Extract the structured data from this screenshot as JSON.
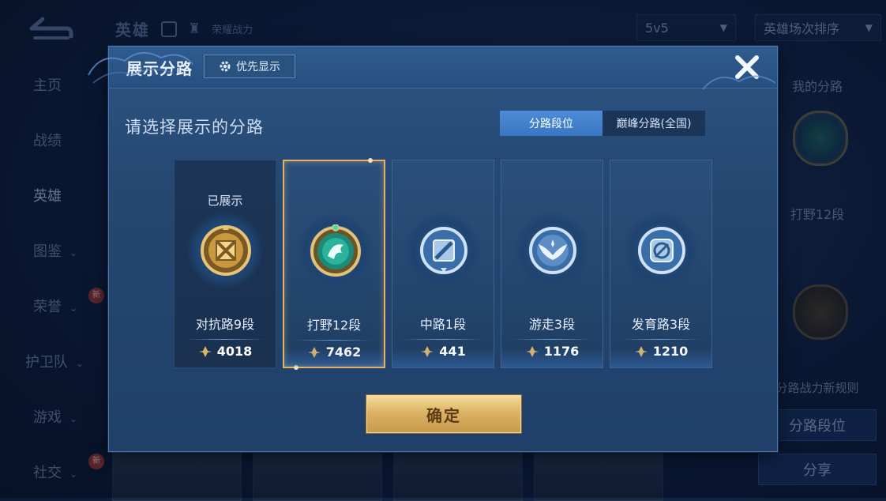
{
  "background": {
    "top_title": "英雄",
    "top_subtitle": "荣耀战力",
    "mode_dropdown": "5v5",
    "sort_dropdown": "英雄场次排序",
    "sidebar": [
      {
        "label": "主页",
        "chevron": false,
        "new": false
      },
      {
        "label": "战绩",
        "chevron": false,
        "new": false
      },
      {
        "label": "英雄",
        "chevron": false,
        "new": false,
        "active": true
      },
      {
        "label": "图鉴",
        "chevron": true,
        "new": false
      },
      {
        "label": "荣誉",
        "chevron": true,
        "new": true
      },
      {
        "label": "护卫队",
        "chevron": true,
        "new": false
      },
      {
        "label": "游戏",
        "chevron": true,
        "new": false
      },
      {
        "label": "社交",
        "chevron": true,
        "new": true
      }
    ],
    "new_badge": "新",
    "right_panel": {
      "my_lane_label": "我的分路",
      "my_lane_value": "打野12段",
      "rules_link": "分路战力新规则",
      "lane_rank_button": "分路段位",
      "share_button": "分享"
    }
  },
  "modal": {
    "title": "展示分路",
    "priority_button": "优先显示",
    "prompt": "请选择展示的分路",
    "tabs": [
      {
        "label": "分路段位",
        "active": true
      },
      {
        "label": "巅峰分路(全国)",
        "active": false
      }
    ],
    "cards": [
      {
        "tag": "已展示",
        "lane": "对抗路9段",
        "score": "4018",
        "emblem": "gold-crossed-swords-icon",
        "state": "shown"
      },
      {
        "tag": "",
        "lane": "打野12段",
        "score": "7462",
        "emblem": "jade-dragon-icon",
        "state": "selected"
      },
      {
        "tag": "",
        "lane": "中路1段",
        "score": "441",
        "emblem": "silver-staff-icon",
        "state": "normal"
      },
      {
        "tag": "",
        "lane": "游走3段",
        "score": "1176",
        "emblem": "silver-wings-icon",
        "state": "normal"
      },
      {
        "tag": "",
        "lane": "发育路3段",
        "score": "1210",
        "emblem": "silver-arrow-icon",
        "state": "normal"
      }
    ],
    "confirm_button": "确定"
  },
  "colors": {
    "accent_blue": "#3a77c2",
    "gold_border": "#e2b26a",
    "confirm_gold": "#dcb265"
  }
}
